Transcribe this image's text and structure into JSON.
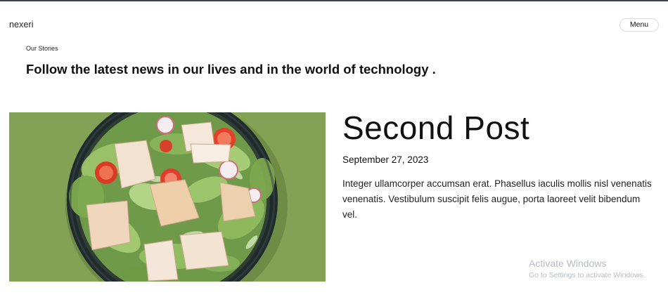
{
  "header": {
    "brand": "nexeri",
    "menu_label": "Menu"
  },
  "section": {
    "eyebrow": "Our Stories",
    "headline": "Follow the latest news in our lives and in the world of technology ."
  },
  "post": {
    "title": "Second Post",
    "date": "September 27, 2023",
    "excerpt": "Integer ullamcorper accumsan erat. Phasellus iaculis mollis nisl venenatis venenatis. Vestibulum suscipit felis augue, porta laoreet velit bibendum vel.",
    "image_alt": "salad-bowl-photo"
  },
  "watermark": {
    "title": "Activate Windows",
    "subtitle": "Go to Settings to activate Windows."
  },
  "colors": {
    "image_background": "#86a558",
    "bowl": "#1f2a2c",
    "watermark": "#b9bcc0"
  }
}
